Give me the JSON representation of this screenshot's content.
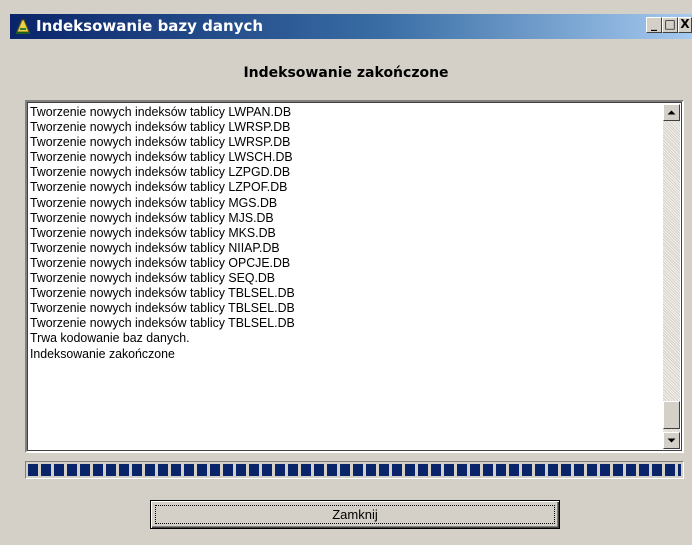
{
  "window": {
    "title": "Indeksowanie bazy danych",
    "controls": {
      "minimize": "_",
      "maximize": "□",
      "close": "X"
    }
  },
  "heading": "Indeksowanie zakończone",
  "log": [
    "Tworzenie nowych indeksów tablicy LWPAN.DB",
    "Tworzenie nowych indeksów tablicy LWRSP.DB",
    "Tworzenie nowych indeksów tablicy LWRSP.DB",
    "Tworzenie nowych indeksów tablicy LWSCH.DB",
    "Tworzenie nowych indeksów tablicy LZPGD.DB",
    "Tworzenie nowych indeksów tablicy LZPOF.DB",
    "Tworzenie nowych indeksów tablicy MGS.DB",
    "Tworzenie nowych indeksów tablicy MJS.DB",
    "Tworzenie nowych indeksów tablicy MKS.DB",
    "Tworzenie nowych indeksów tablicy NIIAP.DB",
    "Tworzenie nowych indeksów tablicy OPCJE.DB",
    "Tworzenie nowych indeksów tablicy SEQ.DB",
    "Tworzenie nowych indeksów tablicy TBLSEL.DB",
    "Tworzenie nowych indeksów tablicy TBLSEL.DB",
    "Tworzenie nowych indeksów tablicy TBLSEL.DB",
    "Trwa kodowanie baz danych.",
    "Indeksowanie zakończone"
  ],
  "progress": {
    "fraction": 1.0,
    "color": "#0a246a"
  },
  "buttons": {
    "close_label": "Zamknij"
  },
  "colors": {
    "titlebar_start": "#0a246a",
    "titlebar_end": "#a6caf0",
    "face": "#d4d0c8"
  },
  "icons": {
    "app": "app-icon",
    "scroll_up": "arrow-up-icon",
    "scroll_down": "arrow-down-icon"
  }
}
